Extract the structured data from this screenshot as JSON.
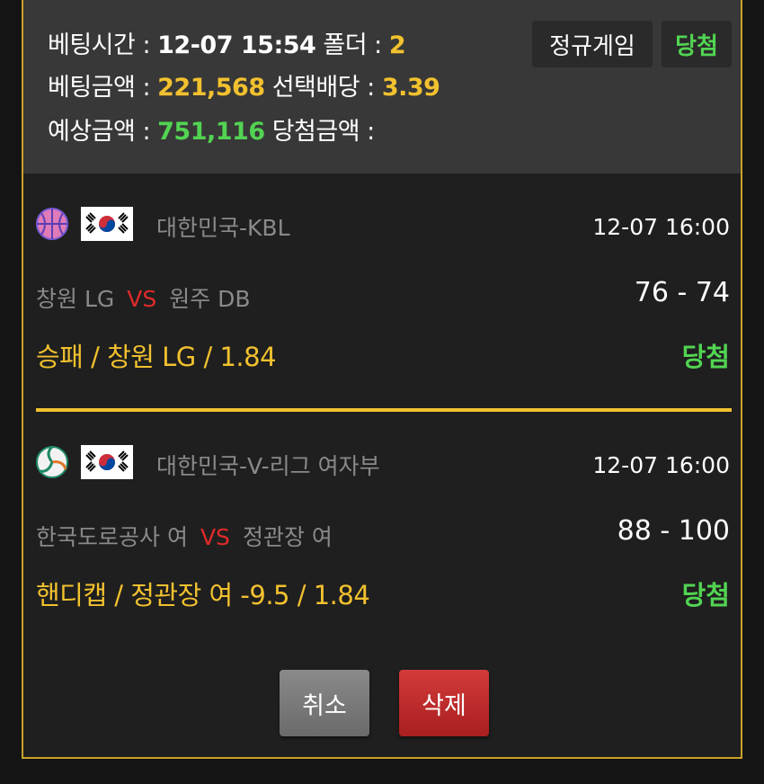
{
  "summary": {
    "bet_time_label": "베팅시간 : ",
    "bet_time_value": "12-07 15:54",
    "folder_label": " 폴더 : ",
    "folder_value": "2",
    "bet_amount_label": "베팅금액 : ",
    "bet_amount_value": "221,568",
    "odds_label": " 선택배당 : ",
    "odds_value": "3.39",
    "expected_label": "예상금액 : ",
    "expected_value": "751,116",
    "win_amount_label": " 당첨금액 : ",
    "game_type": "정규게임",
    "result": "당첨"
  },
  "matches": [
    {
      "sport_icon": "basketball-icon",
      "flag_icon": "korea-flag-icon",
      "league": "대한민국-KBL",
      "time": "12-07 16:00",
      "home": "창원 LG",
      "vs": "VS",
      "away": "원주 DB",
      "score": "76 - 74",
      "pick": "승패 / 창원 LG / 1.84",
      "result": "당첨"
    },
    {
      "sport_icon": "volleyball-icon",
      "flag_icon": "korea-flag-icon",
      "league": "대한민국-V-리그 여자부",
      "time": "12-07 16:00",
      "home": "한국도로공사 여",
      "vs": "VS",
      "away": "정관장 여",
      "score": "88 - 100",
      "pick": "핸디캡 / 정관장 여 -9.5 / 1.84",
      "result": "당첨"
    }
  ],
  "buttons": {
    "cancel": "취소",
    "delete": "삭제"
  },
  "colors": {
    "accent_gold": "#f2c12e",
    "win_green": "#52d452",
    "vs_red": "#e02a2a",
    "delete_red": "#c62b2b",
    "panel_border": "#c9a227"
  }
}
